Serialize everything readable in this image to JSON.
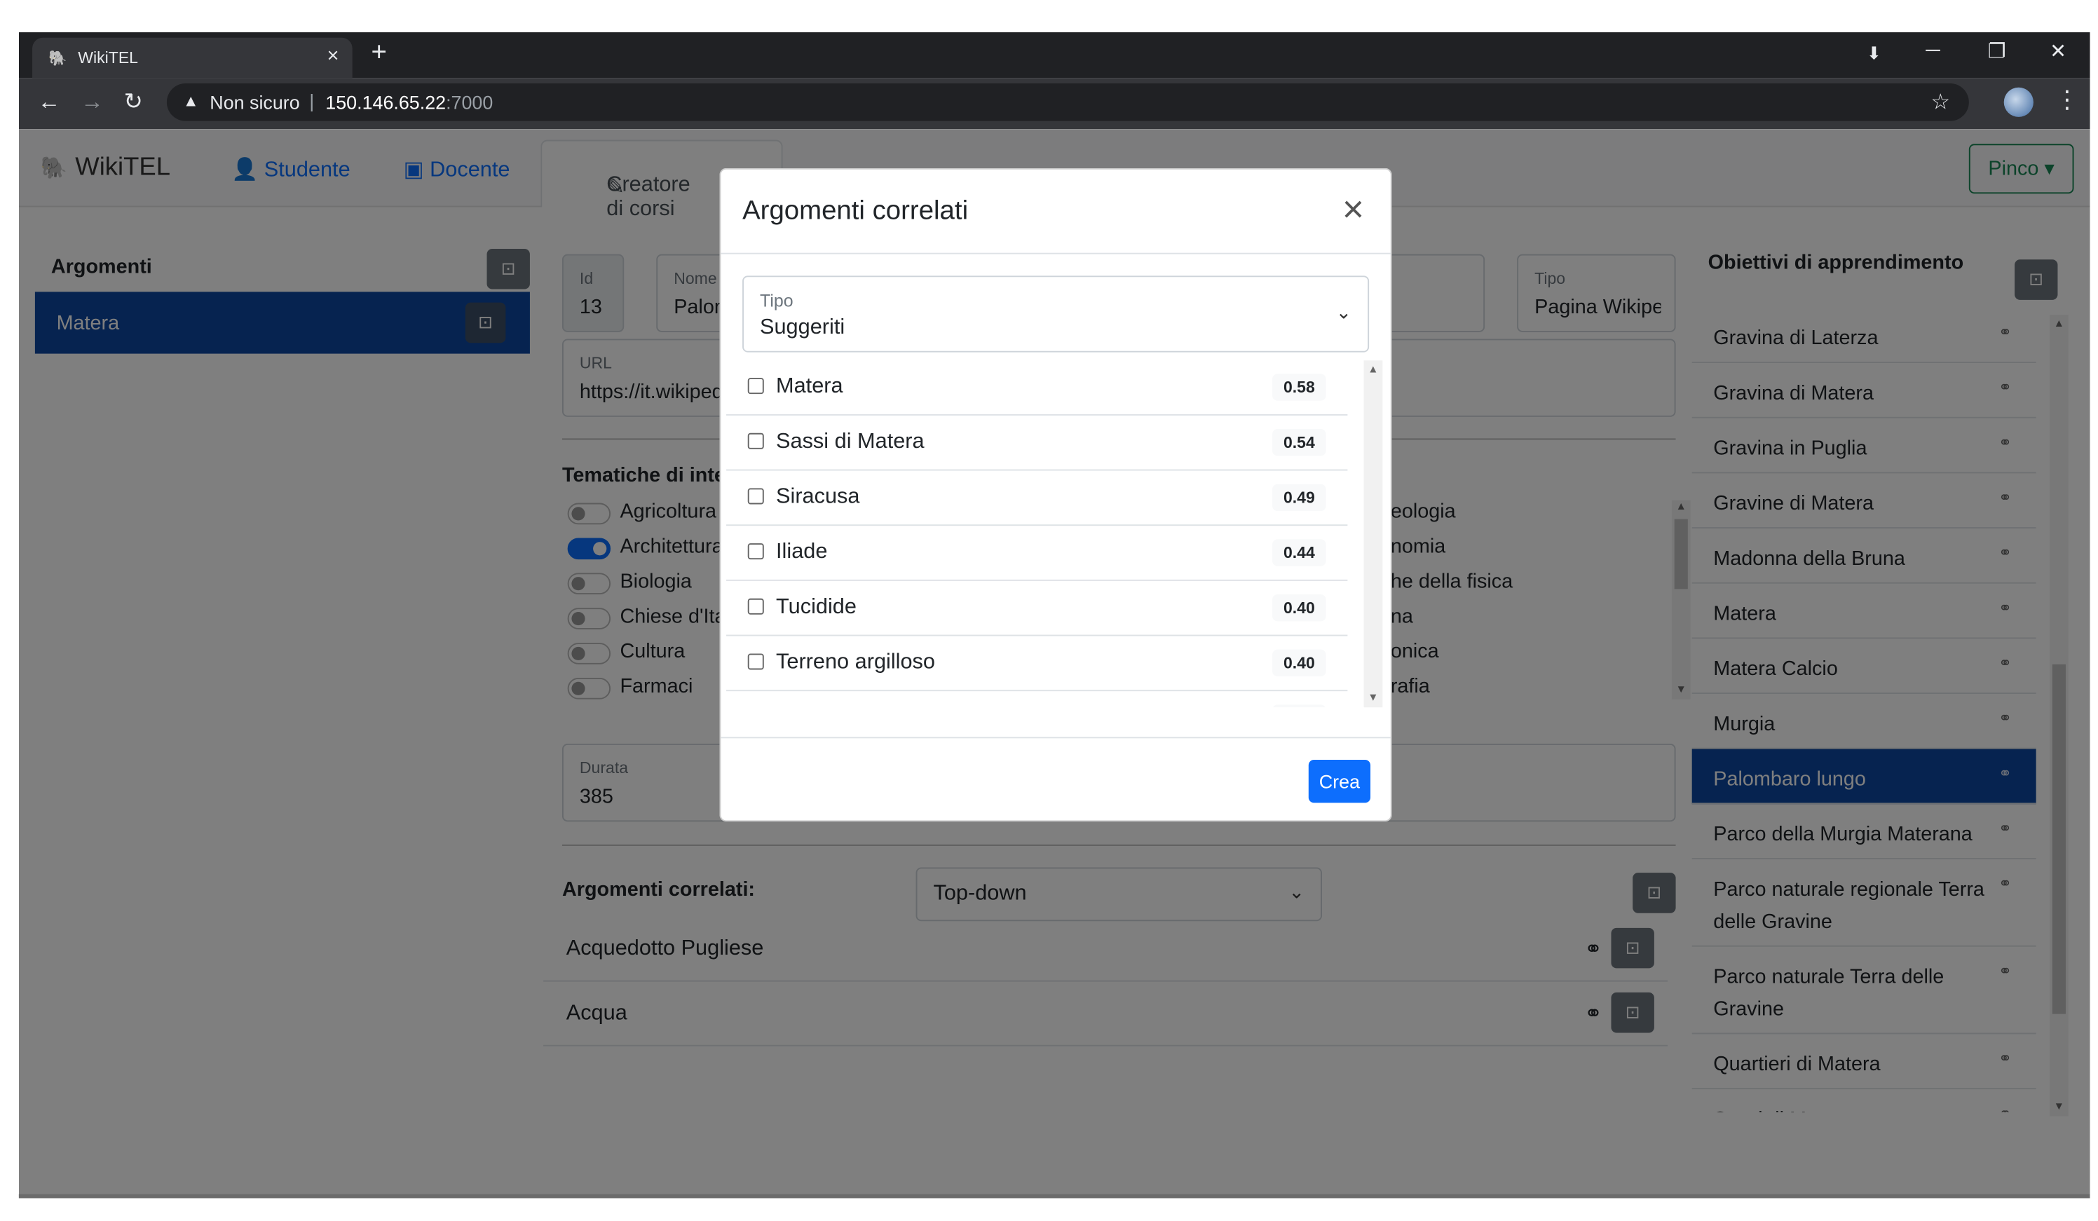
{
  "browser": {
    "tab_title": "WikiTEL",
    "tab_close": "×",
    "new_tab": "+",
    "security": "Non sicuro",
    "separator": "|",
    "url_host": "150.146.65.22",
    "url_port": ":7000",
    "win_min": "─",
    "win_max": "❐",
    "win_close": "✕"
  },
  "navbar": {
    "brand": "WikiTEL",
    "studente": "Studente",
    "docente": "Docente",
    "creatore": "Creatore di corsi",
    "user": "Pinco"
  },
  "left": {
    "title": "Argomenti",
    "selected": "Matera"
  },
  "form": {
    "id_label": "Id",
    "id_value": "13",
    "nome_label": "Nome",
    "nome_value": "Palombaro lungo",
    "tipo_label": "Tipo",
    "tipo_value": "Pagina Wikipedia",
    "url_label": "URL",
    "url_value": "https://it.wikipedia.org/wiki/Palombaro_lungo",
    "tematiche_label": "Tematiche di interesse",
    "toggles_left": [
      {
        "label": "Agricoltura",
        "on": false
      },
      {
        "label": "Architettura",
        "on": true
      },
      {
        "label": "Biologia",
        "on": false
      },
      {
        "label": "Chiese d'Italia",
        "on": false
      },
      {
        "label": "Cultura",
        "on": false
      },
      {
        "label": "Farmaci",
        "on": false
      }
    ],
    "toggles_right_visible": [
      "eologia",
      "nomia",
      "he della fisica",
      "na",
      "onica",
      "rafia"
    ],
    "durata_label": "Durata",
    "durata_value": "385"
  },
  "related": {
    "title": "Argomenti correlati:",
    "mode": "Top-down",
    "items": [
      "Acquedotto Pugliese",
      "Acqua"
    ]
  },
  "goals": {
    "title": "Obiettivi di apprendimento",
    "items": [
      "Gravina di Laterza",
      "Gravina di Matera",
      "Gravina in Puglia",
      "Gravine di Matera",
      "Madonna della Bruna",
      "Matera",
      "Matera Calcio",
      "Murgia",
      "Palombaro lungo",
      "Parco della Murgia Materana",
      "Parco naturale regionale Terra delle Gravine",
      "Parco naturale Terra delle Gravine",
      "Quartieri di Matera",
      "Sassi di Matera"
    ],
    "active_index": 8
  },
  "modal": {
    "title": "Argomenti correlati",
    "close": "×",
    "tipo_label": "Tipo",
    "tipo_value": "Suggeriti",
    "suggestions": [
      {
        "name": "Matera",
        "score": "0.58"
      },
      {
        "name": "Sassi di Matera",
        "score": "0.54"
      },
      {
        "name": "Siracusa",
        "score": "0.49"
      },
      {
        "name": "Iliade",
        "score": "0.44"
      },
      {
        "name": "Tucidide",
        "score": "0.40"
      },
      {
        "name": "Terreno argilloso",
        "score": "0.40"
      },
      {
        "name": "",
        "score": ""
      }
    ],
    "create": "Crea"
  },
  "icons": {
    "folder": "folder-plus-icon",
    "link": "link-icon",
    "chevron": "chevron-down-icon"
  }
}
